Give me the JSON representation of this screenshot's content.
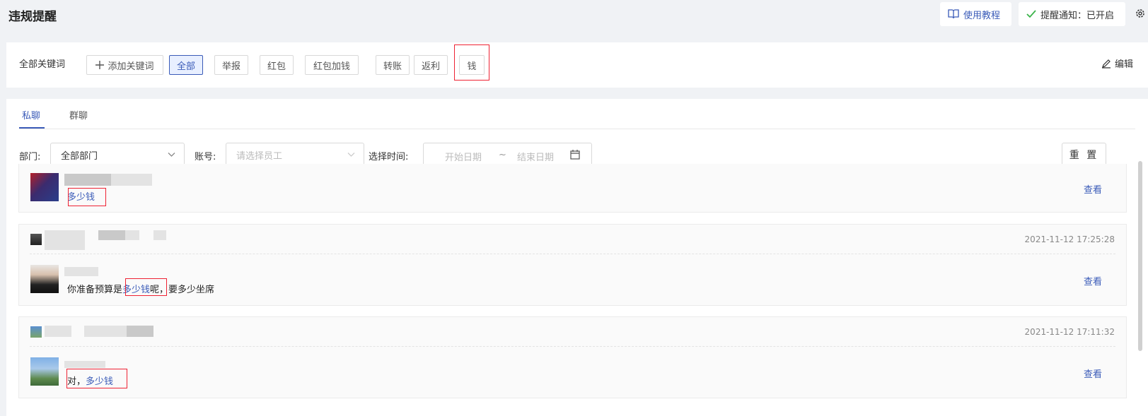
{
  "header": {
    "title": "违规提醒",
    "tutorial_label": "使用教程",
    "notify_label": "提醒通知：已开启"
  },
  "keywords": {
    "title": "全部关键词",
    "add_label": "添加关键词",
    "edit_label": "编辑",
    "tags": [
      "全部",
      "举报",
      "红包",
      "红包加钱",
      "转账",
      "返利",
      "钱"
    ],
    "active_index": 0,
    "highlighted_index": 6
  },
  "tabs": [
    "私聊",
    "群聊"
  ],
  "filters": {
    "department_label": "部门:",
    "department_value": "全部部门",
    "account_label": "账号:",
    "account_placeholder": "请选择员工",
    "time_label": "选择时间:",
    "start_placeholder": "开始日期",
    "range_separator": "~",
    "end_placeholder": "结束日期",
    "reset_label": "重 置"
  },
  "messages": [
    {
      "timestamp": "",
      "text_prefix": "",
      "text_highlight": "多少钱",
      "text_suffix": "",
      "view_label": "查看"
    },
    {
      "timestamp": "2021-11-12 17:25:28",
      "text_prefix": "你准备预算是",
      "text_highlight": "多少钱",
      "text_suffix": "呢，要多少坐席",
      "view_label": "查看"
    },
    {
      "timestamp": "2021-11-12 17:11:32",
      "text_prefix": "对，",
      "text_highlight": "多少钱",
      "text_suffix": "",
      "view_label": "查看"
    }
  ],
  "colors": {
    "accent": "#3a5bb8",
    "highlight_box": "#ee2233",
    "page_bg": "#f0f2f5"
  }
}
